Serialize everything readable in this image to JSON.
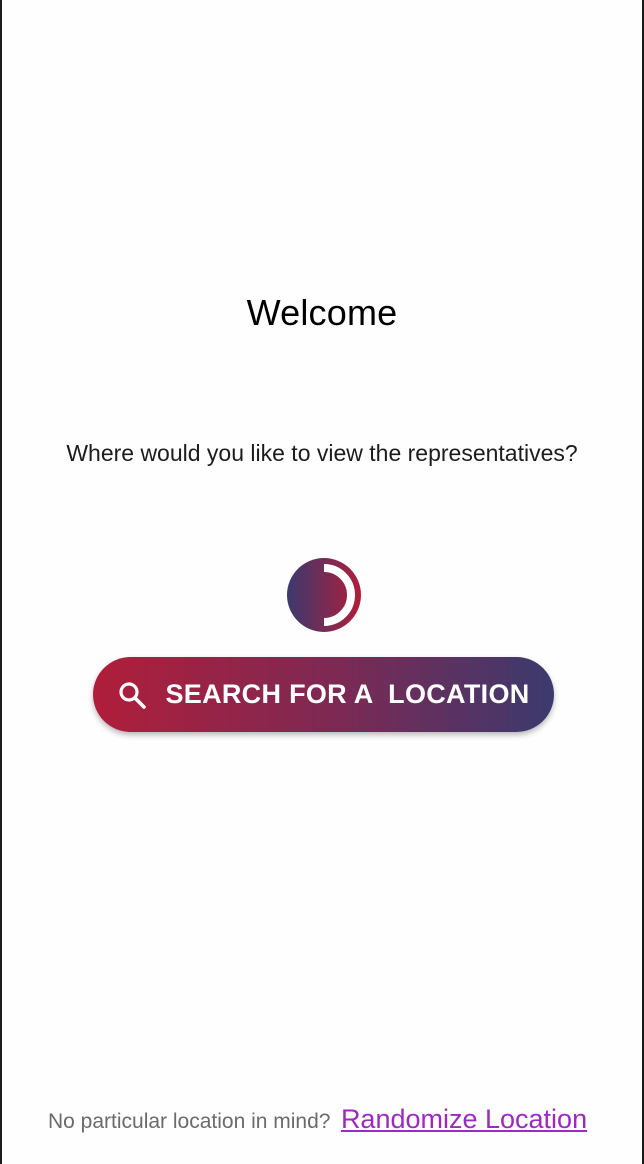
{
  "welcome": {
    "title": "Welcome",
    "prompt": "Where would you like to view the representatives?"
  },
  "logo": {
    "icon": "half-circle-logo-icon",
    "colors": {
      "gradient_start": "#3b3a6e",
      "gradient_end": "#b01e3a",
      "arc": "#ffffff"
    }
  },
  "search_button": {
    "label": "SEARCH FOR A  LOCATION",
    "icon": "search-icon",
    "colors": {
      "gradient_start": "#b01e3a",
      "gradient_end": "#3b3a6e",
      "text": "#ffffff"
    }
  },
  "footer": {
    "hint": "No particular location in mind?",
    "link_label": "Randomize Location",
    "link_color": "#9b2bbf"
  }
}
